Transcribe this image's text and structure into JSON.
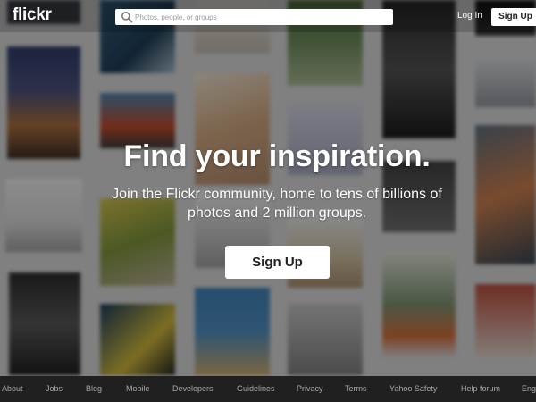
{
  "header": {
    "logo": "flickr",
    "search_placeholder": "Photos, people, or groups",
    "login_label": "Log In",
    "signup_label": "Sign Up"
  },
  "hero": {
    "title": "Find your inspiration.",
    "subtitle": "Join the Flickr community, home to tens of billions of photos and 2 million groups.",
    "cta_label": "Sign Up"
  },
  "footer": {
    "links": [
      "About",
      "Jobs",
      "Blog",
      "Mobile",
      "Developers",
      "Guidelines",
      "Privacy",
      "Terms",
      "Yahoo Safety",
      "Help forum",
      "Eng"
    ]
  },
  "icons": {
    "search": "search-icon"
  }
}
